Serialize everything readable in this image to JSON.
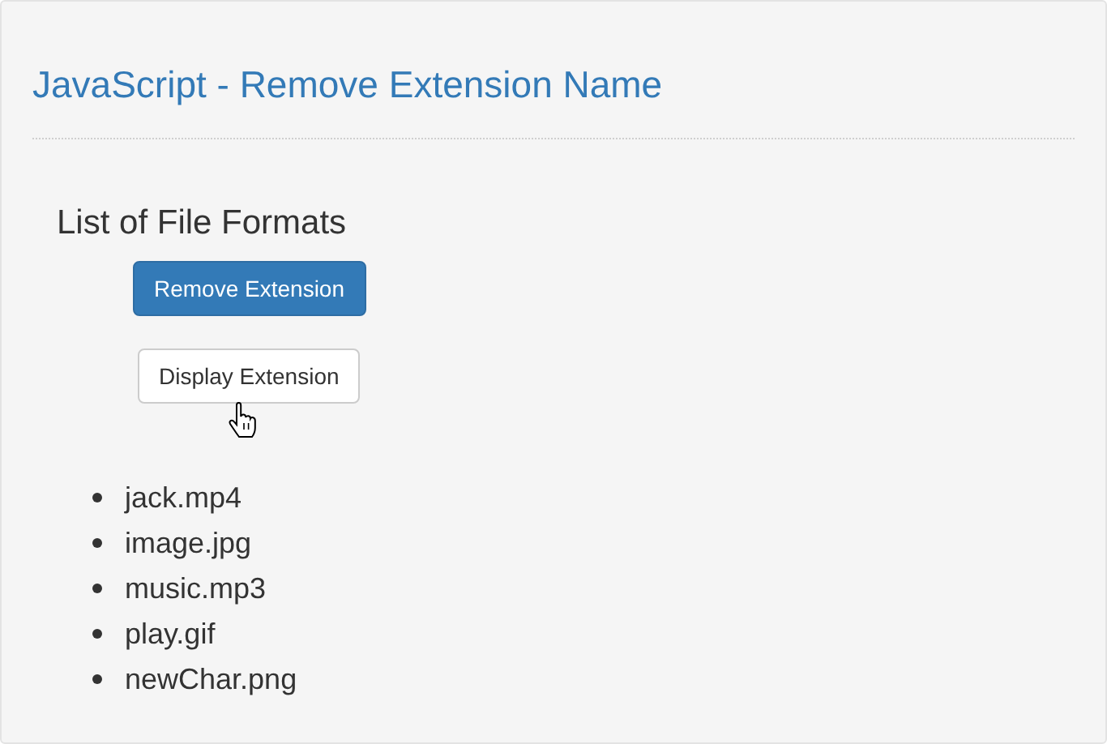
{
  "page_title": "JavaScript - Remove Extension Name",
  "section_heading": "List of File Formats",
  "buttons": [
    {
      "label": "Remove Extension",
      "kind": "primary"
    },
    {
      "label": "Display Extension",
      "kind": "default"
    }
  ],
  "files": [
    "jack.mp4",
    "image.jpg",
    "music.mp3",
    "play.gif",
    "newChar.png"
  ]
}
